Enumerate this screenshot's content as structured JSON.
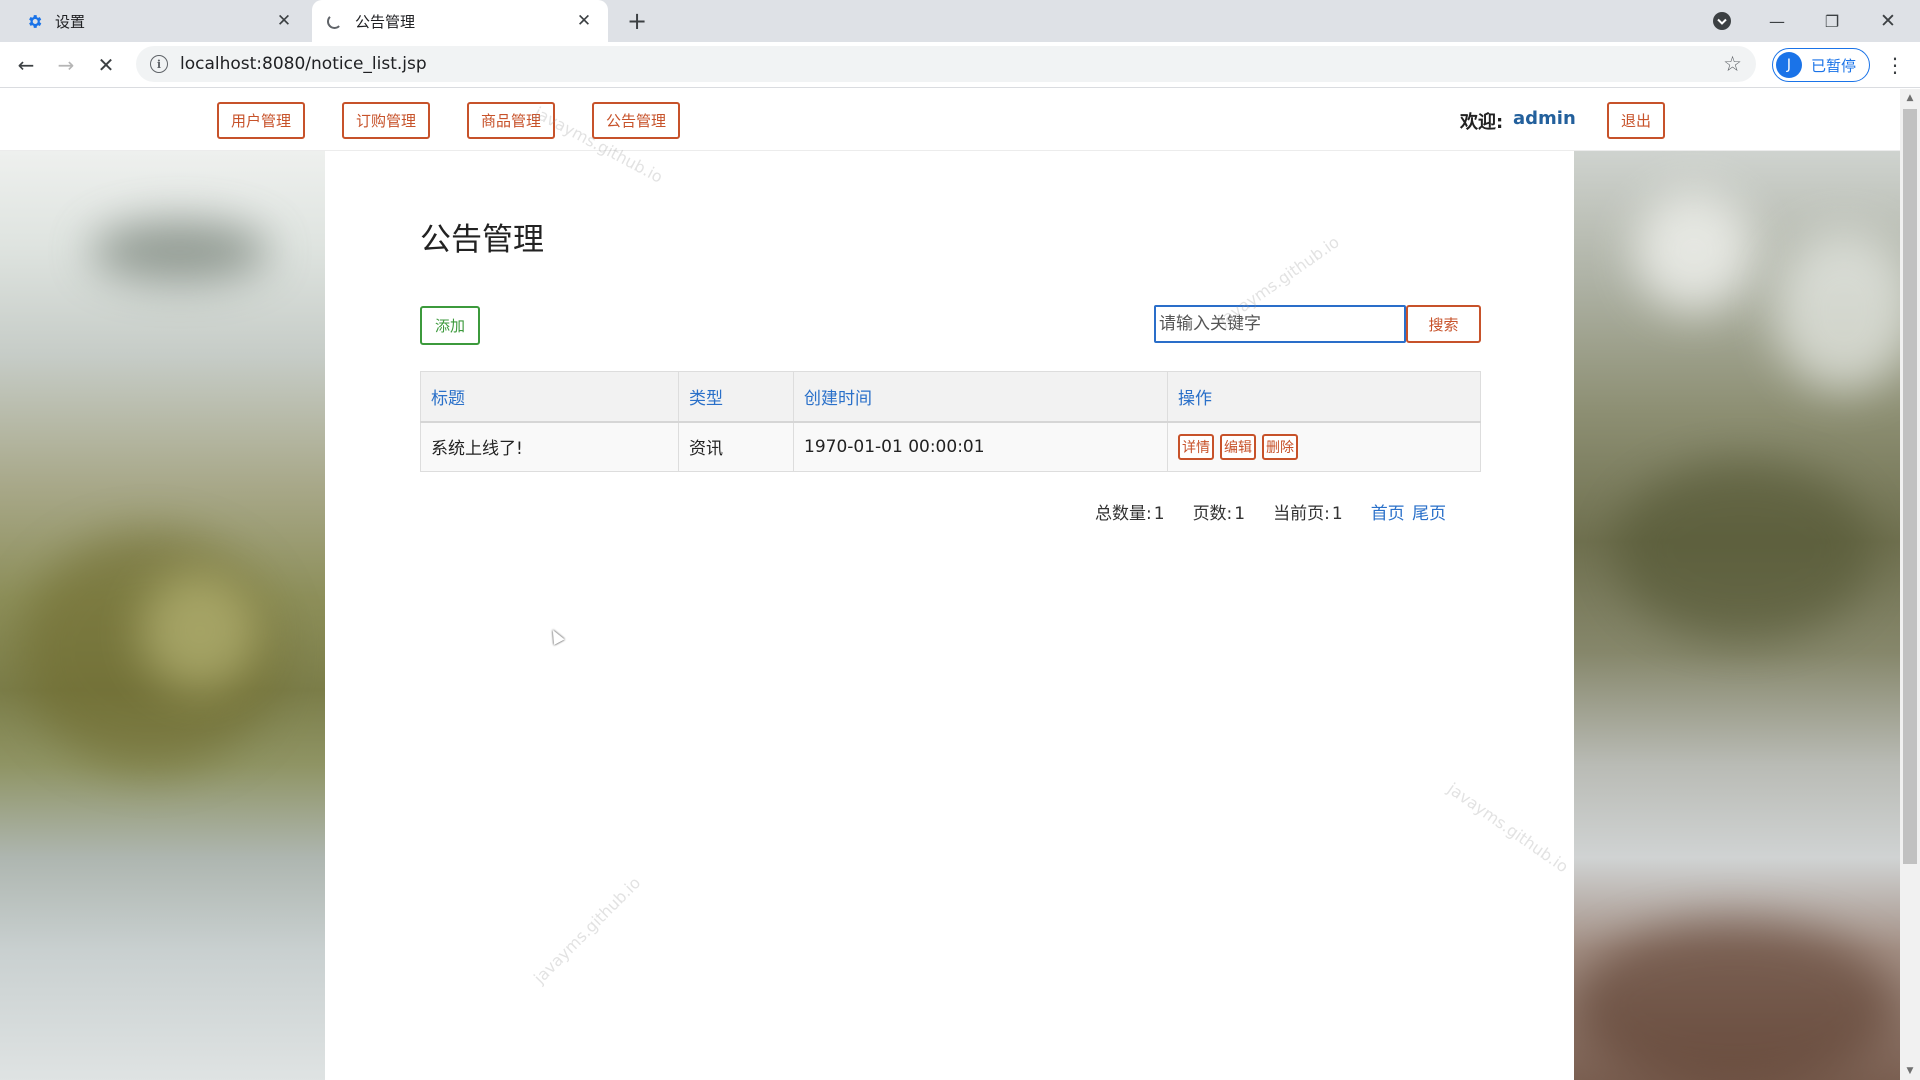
{
  "browser": {
    "tabs": [
      {
        "title": "设置",
        "icon": "gear-icon",
        "active": false
      },
      {
        "title": "公告管理",
        "icon": "loading-spinner-icon",
        "active": true
      }
    ],
    "url": "localhost:8080/notice_list.jsp",
    "profile": {
      "initial": "J",
      "label": "已暂停"
    }
  },
  "nav": {
    "items": [
      "用户管理",
      "订购管理",
      "商品管理",
      "公告管理"
    ],
    "welcome_label": "欢迎:",
    "user": "admin",
    "logout": "退出"
  },
  "page": {
    "title": "公告管理",
    "add_label": "添加",
    "search_placeholder": "请输入关键字",
    "search_label": "搜索"
  },
  "table": {
    "headers": [
      "标题",
      "类型",
      "创建时间",
      "操作"
    ],
    "rows": [
      {
        "title": "系统上线了!",
        "type": "资讯",
        "created": "1970-01-01 00:00:01",
        "actions": [
          "详情",
          "编辑",
          "删除"
        ]
      }
    ]
  },
  "pagination": {
    "total_label": "总数量:",
    "total": "1",
    "pages_label": "页数:",
    "pages": "1",
    "current_label": "当前页:",
    "current": "1",
    "first": "首页",
    "last": "尾页"
  },
  "watermark": "javayms.github.io",
  "colors": {
    "accent_red": "#c7522a",
    "accent_green": "#3c9a3c",
    "link_blue": "#2a70c9"
  }
}
